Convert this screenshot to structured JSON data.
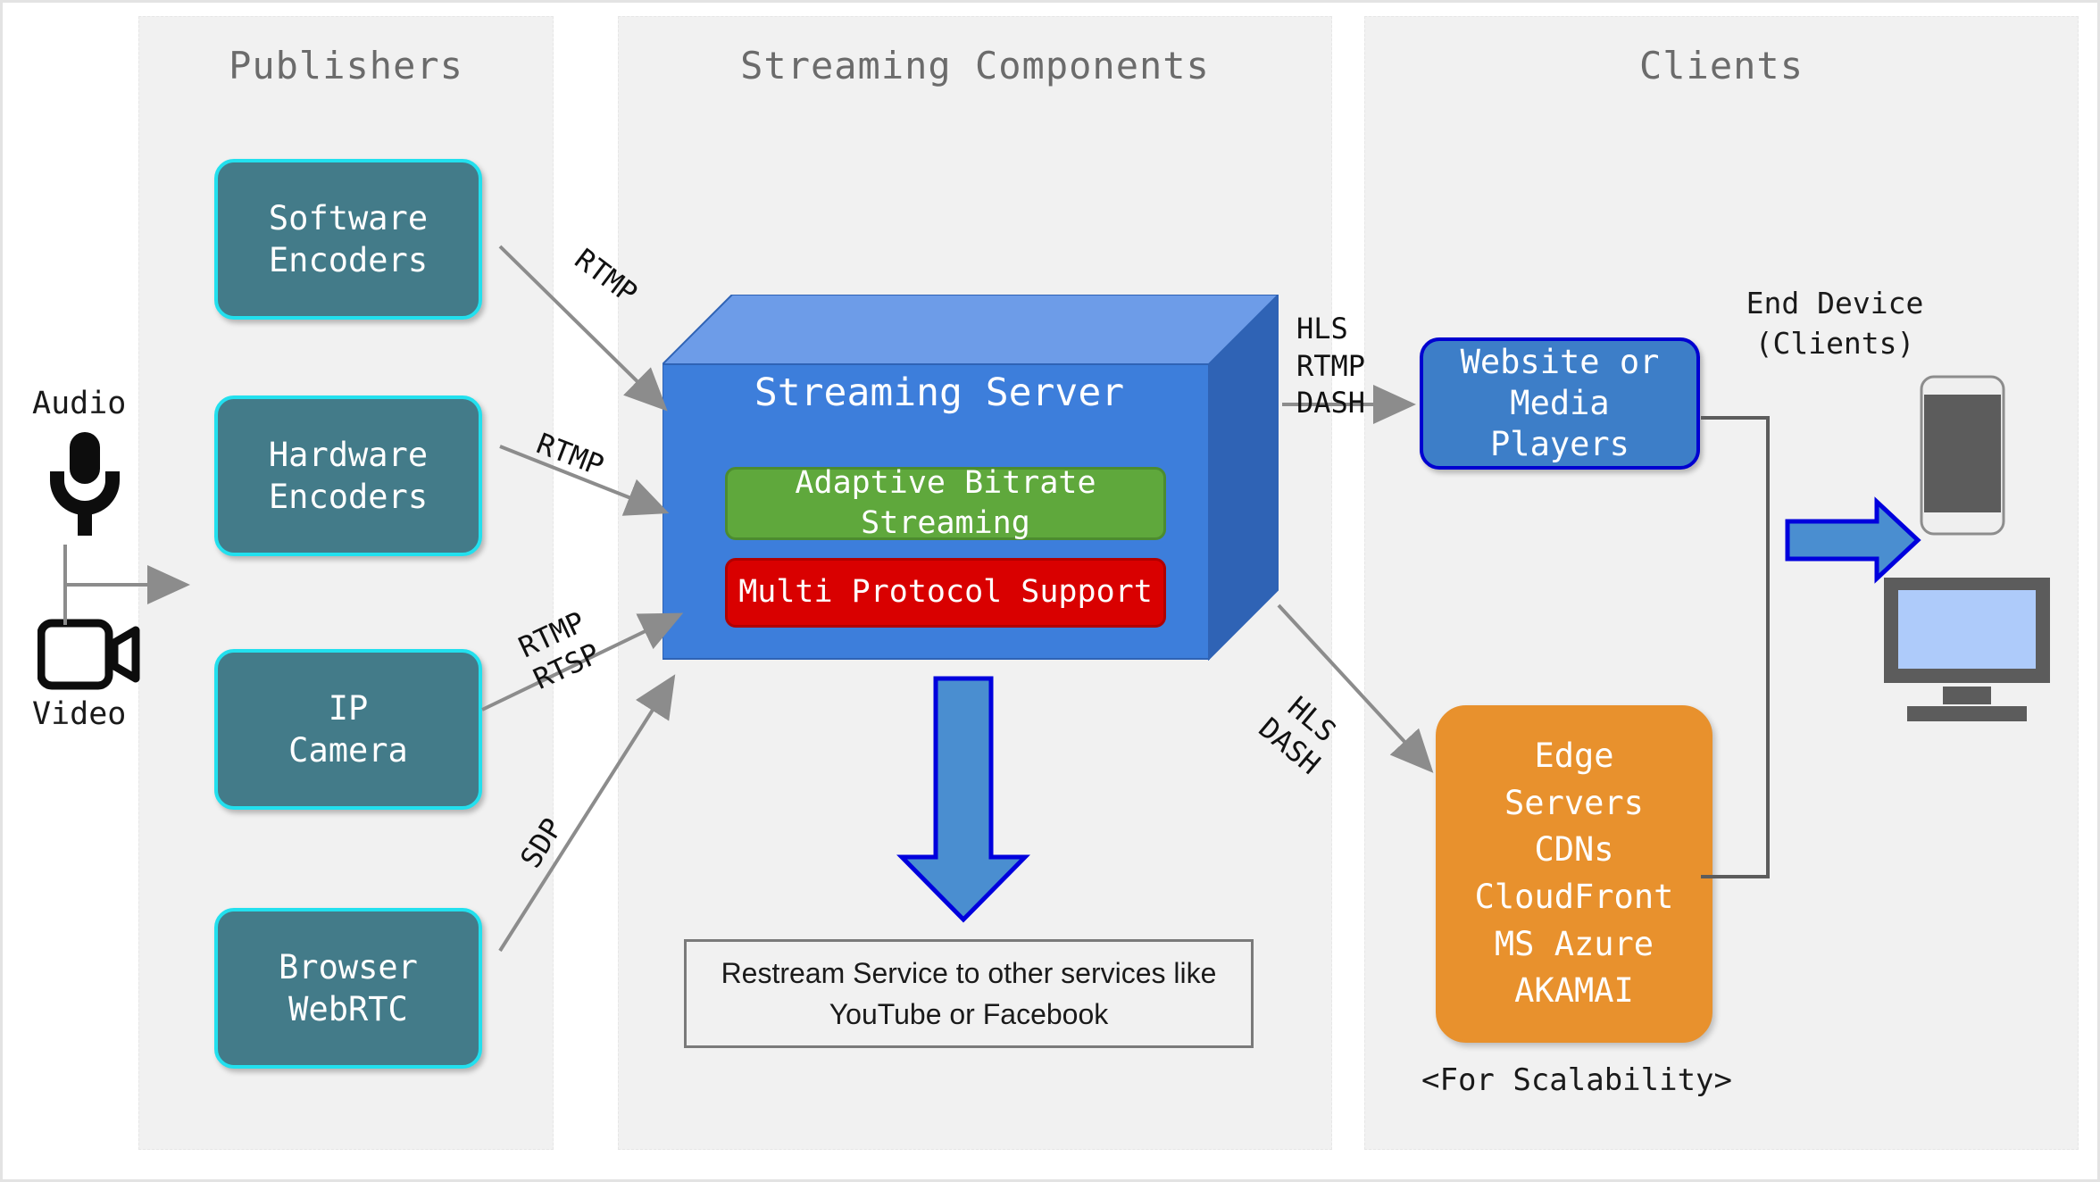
{
  "lanes": [
    {
      "id": "publishers",
      "title": "Publishers"
    },
    {
      "id": "streaming",
      "title": "Streaming Components"
    },
    {
      "id": "clients",
      "title": "Clients"
    }
  ],
  "sources": {
    "audio_label": "Audio",
    "video_label": "Video",
    "audio_icon": "microphone-icon",
    "video_icon": "video-camera-icon"
  },
  "publishers": [
    {
      "id": "software",
      "label": "Software\nEncoders"
    },
    {
      "id": "hardware",
      "label": "Hardware\nEncoders"
    },
    {
      "id": "ipcam",
      "label": "IP\nCamera"
    },
    {
      "id": "browser",
      "label": "Browser\nWebRTC"
    }
  ],
  "server": {
    "title": "Streaming Server",
    "features": [
      {
        "id": "abr",
        "label": "Adaptive Bitrate\nStreaming",
        "color": "#5fa83c"
      },
      {
        "id": "mps",
        "label": "Multi Protocol Support",
        "color": "#d90000"
      }
    ]
  },
  "restream": {
    "label": "Restream Service to other services like\nYouTube or Facebook"
  },
  "clients": {
    "website": {
      "label": "Website or\nMedia\nPlayers"
    },
    "edge": {
      "label": "Edge\nServers\nCDNs\nCloudFront\nMS Azure\nAKAMAI"
    },
    "scalability_note": "<For Scalability>",
    "end_device": {
      "label": "End Device\n(Clients)"
    },
    "phone_icon": "smartphone-icon",
    "monitor_icon": "desktop-monitor-icon"
  },
  "edges": {
    "software_to_server": "RTMP",
    "hardware_to_server": "RTMP",
    "ipcam_to_server": "RTMP\nRTSP",
    "browser_to_server": "SDP",
    "server_to_website": "HLS\nRTMP\nDASH",
    "server_to_edge": "HLS\nDASH"
  },
  "colors": {
    "lane_bg": "#f1f1f1",
    "lane_title": "#6b6b6b",
    "publisher_fill": "#437b89",
    "publisher_border": "#22e0ee",
    "server_front": "#3d7edb",
    "server_top": "#6d9ce8",
    "server_side": "#2f63b5",
    "abr_green": "#5fa83c",
    "mps_red": "#d90000",
    "website_fill": "#3d7ec8",
    "website_border": "#0000d0",
    "edge_orange": "#e8912d",
    "arrow_grey": "#8c8c8c",
    "big_arrow_fill": "#4a8ed0",
    "big_arrow_border": "#0000dd",
    "icon_dark": "#5c5c5c",
    "screen_blue": "#aecbfa"
  }
}
